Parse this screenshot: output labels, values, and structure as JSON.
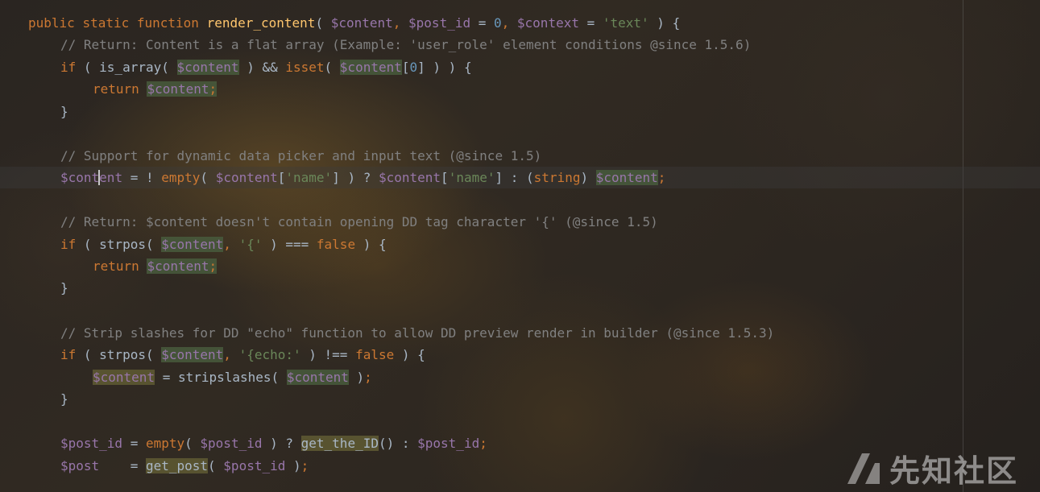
{
  "code": {
    "line1": {
      "kw_public": "public",
      "kw_static": "static",
      "kw_function": "function",
      "fn_name": "render_content",
      "open": "( ",
      "p_content": "$content",
      "sep1": ", ",
      "p_post_id": "$post_id",
      "eq1": " = ",
      "zero": "0",
      "sep2": ", ",
      "p_context": "$context",
      "eq2": " = ",
      "s_text": "'text'",
      "close": " ) {"
    },
    "line2": {
      "comment": "// Return: Content is a flat array (Example: 'user_role' element conditions @since 1.5.6)"
    },
    "line3": {
      "kw_if": "if",
      "a": " ( is_array( ",
      "v1": "$content",
      "b": " ) && ",
      "f_isset": "isset",
      "c": "( ",
      "v2": "$content",
      "d": "[",
      "n0": "0",
      "e": "] ) ) {"
    },
    "line4": {
      "kw_return": "return",
      "sp": " ",
      "v": "$content",
      "semi": ";"
    },
    "line5": {
      "brace": "}"
    },
    "line7": {
      "comment": "// Support for dynamic data picker and input text (@since 1.5)"
    },
    "line8": {
      "v1a": "$cont",
      "v1b": "ent",
      "a": " = ! ",
      "f_empty": "empty",
      "b": "( ",
      "v2": "$content",
      "c": "[",
      "s1": "'name'",
      "d": "] ) ? ",
      "v3": "$content",
      "e": "[",
      "s2": "'name'",
      "f": "] : (",
      "k_string": "string",
      "g": ") ",
      "v4": "$content",
      "semi": ";"
    },
    "line10": {
      "comment": "// Return: $content doesn't contain opening DD tag character '{' (@since 1.5)"
    },
    "line11": {
      "kw_if": "if",
      "a": " ( strpos( ",
      "v": "$content",
      "sep": ", ",
      "s": "'{'",
      "b": " ) === ",
      "k_false": "false",
      "c": " ) {"
    },
    "line12": {
      "kw_return": "return",
      "sp": " ",
      "v": "$content",
      "semi": ";"
    },
    "line13": {
      "brace": "}"
    },
    "line15": {
      "comment": "// Strip slashes for DD \"echo\" function to allow DD preview render in builder (@since 1.5.3)"
    },
    "line16": {
      "kw_if": "if",
      "a": " ( strpos( ",
      "v": "$content",
      "sep": ", ",
      "s": "'{echo:'",
      "b": " ) !== ",
      "k_false": "false",
      "c": " ) {"
    },
    "line17": {
      "v1": "$content",
      "a": " = stripslashes( ",
      "v2": "$content",
      "b": " )",
      "semi": ";"
    },
    "line18": {
      "brace": "}"
    },
    "line20": {
      "v1": "$post_id",
      "a": " = ",
      "f_empty": "empty",
      "b": "( ",
      "v2": "$post_id",
      "c": " ) ? ",
      "fn_get": "get_the_ID",
      "d": "() : ",
      "v3": "$post_id",
      "semi": ";"
    },
    "line21": {
      "v1": "$post",
      "a": "    = ",
      "fn_get": "get_post",
      "b": "( ",
      "v2": "$post_id",
      "c": " )",
      "semi": ";"
    }
  },
  "watermark": {
    "text": "先知社区"
  },
  "colors": {
    "background": "#2b2b2b",
    "keyword": "#cc7832",
    "function": "#ffc66d",
    "variable": "#9876aa",
    "string": "#6a8759",
    "number": "#6897bb",
    "comment": "#808080",
    "plain": "#a9b7c6"
  },
  "icons": {
    "watermark_logo": "xianzhi-logo-icon"
  }
}
